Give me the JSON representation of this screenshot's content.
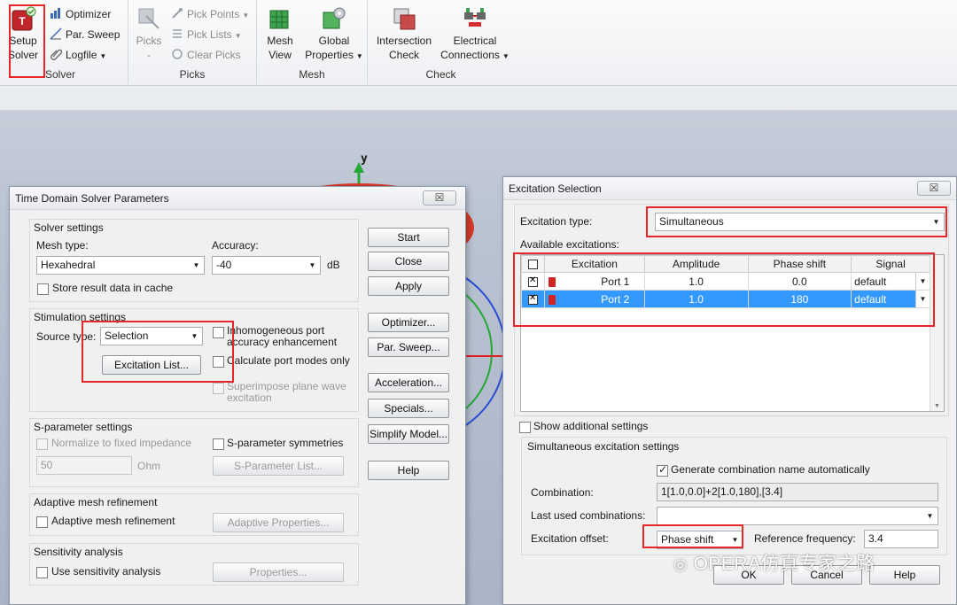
{
  "ribbon": {
    "solver_group": {
      "label": "Solver",
      "setup_solver": "Setup\nSolver",
      "optimizer": "Optimizer",
      "par_sweep": "Par. Sweep",
      "logfile": "Logfile"
    },
    "picks_group": {
      "label": "Picks",
      "picks": "Picks",
      "pick_points": "Pick Points",
      "pick_lists": "Pick Lists",
      "clear_picks": "Clear Picks"
    },
    "mesh_group": {
      "label": "Mesh",
      "mesh_view": "Mesh\nView",
      "global_properties": "Global\nProperties"
    },
    "check_group": {
      "label": "Check",
      "intersection_check": "Intersection\nCheck",
      "electrical_connections": "Electrical\nConnections"
    }
  },
  "viewport": {
    "axis_y": "y"
  },
  "solver_dialog": {
    "title": "Time Domain Solver Parameters",
    "close": "☒",
    "solver_settings": {
      "label": "Solver settings",
      "mesh_type_label": "Mesh type:",
      "mesh_type_value": "Hexahedral",
      "accuracy_label": "Accuracy:",
      "accuracy_value": "-40",
      "accuracy_unit": "dB",
      "store_cache": "Store result data in cache"
    },
    "stimulation": {
      "label": "Stimulation settings",
      "source_type_label": "Source type:",
      "source_type_value": "Selection",
      "excitation_list": "Excitation List...",
      "inhomogeneous": "Inhomogeneous port\naccuracy enhancement",
      "calc_port_modes": "Calculate port modes only",
      "superimpose": "Superimpose plane wave\nexcitation"
    },
    "sparam": {
      "label": "S-parameter settings",
      "normalize": "Normalize to fixed impedance",
      "impedance_value": "50",
      "impedance_unit": "Ohm",
      "symmetries": "S-parameter symmetries",
      "list": "S-Parameter List..."
    },
    "adaptive": {
      "label": "Adaptive mesh refinement",
      "checkbox": "Adaptive mesh refinement",
      "properties": "Adaptive Properties..."
    },
    "sensitivity": {
      "label": "Sensitivity analysis",
      "checkbox": "Use sensitivity analysis",
      "properties": "Properties..."
    },
    "side_buttons": {
      "start": "Start",
      "close": "Close",
      "apply": "Apply",
      "optimizer": "Optimizer...",
      "par_sweep": "Par. Sweep...",
      "acceleration": "Acceleration...",
      "specials": "Specials...",
      "simplify": "Simplify Model...",
      "help": "Help"
    }
  },
  "excitation_dialog": {
    "title": "Excitation Selection",
    "close": "☒",
    "excitation_type_label": "Excitation type:",
    "excitation_type_value": "Simultaneous",
    "available_label": "Available excitations:",
    "columns": [
      "Excitation",
      "Amplitude",
      "Phase shift",
      "Signal"
    ],
    "rows": [
      {
        "name": "Port 1",
        "amplitude": "1.0",
        "phase": "0.0",
        "signal": "default"
      },
      {
        "name": "Port 2",
        "amplitude": "1.0",
        "phase": "180",
        "signal": "default"
      }
    ],
    "show_additional": "Show additional settings",
    "simultaneous_label": "Simultaneous excitation settings",
    "generate_name": "Generate combination name automatically",
    "combination_label": "Combination:",
    "combination_value": "1[1.0,0.0]+2[1.0,180],[3.4]",
    "last_used_label": "Last used combinations:",
    "offset_label": "Excitation offset:",
    "offset_value": "Phase shift",
    "ref_freq_label": "Reference frequency:",
    "ref_freq_value": "3.4",
    "ok": "OK",
    "cancel": "Cancel",
    "help": "Help"
  },
  "watermark": "OPERA仿真专家之路",
  "colors": {
    "highlight": "#e8262a",
    "selection": "#3399ff"
  }
}
